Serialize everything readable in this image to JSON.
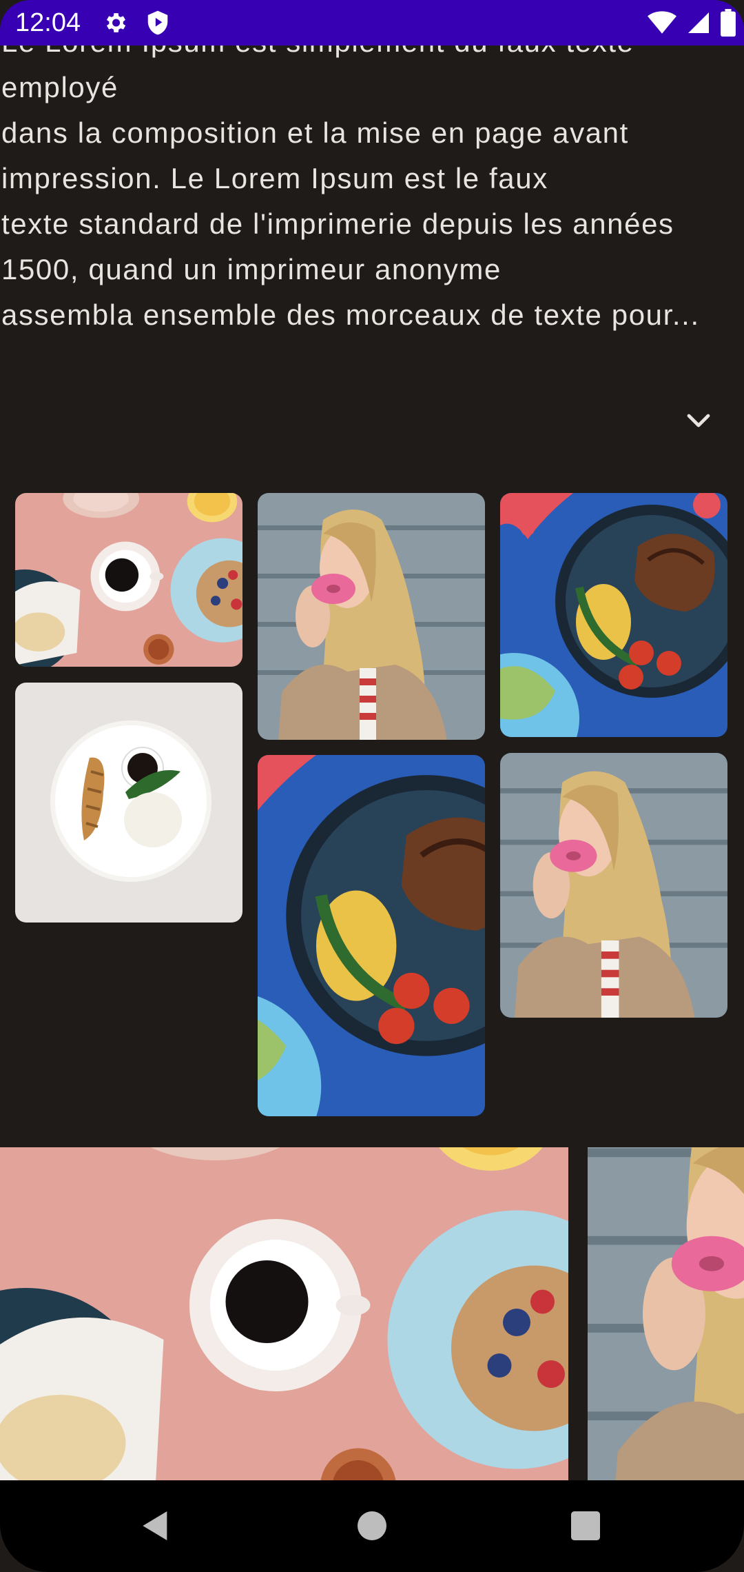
{
  "status_bar": {
    "time": "12:04",
    "background": "#3700b3",
    "left_icons": [
      "settings-icon",
      "shield-play-icon"
    ],
    "right_icons": [
      "wifi-icon",
      "cell-signal-icon",
      "battery-icon"
    ]
  },
  "content": {
    "description": "Le Lorem Ipsum est simplement du faux texte\nemployé\ndans la composition et la mise en page avant\nimpression. Le Lorem Ipsum est le faux\ntexte standard de l'imprimerie depuis les années\n1500, quand un imprimeur anonyme\nassembla ensemble des morceaux de texte pour...",
    "expand_icon": "chevron-down-icon",
    "gallery": [
      {
        "name": "photo-breakfast-table",
        "subject": "breakfast"
      },
      {
        "name": "photo-woman-donut",
        "subject": "woman"
      },
      {
        "name": "photo-steak-plate",
        "subject": "steak"
      },
      {
        "name": "photo-fish-rice-plate",
        "subject": "fish"
      },
      {
        "name": "photo-steak-plate-2",
        "subject": "steak"
      },
      {
        "name": "photo-woman-donut-2",
        "subject": "woman"
      }
    ],
    "carousel": [
      {
        "name": "carousel-breakfast",
        "subject": "breakfast"
      },
      {
        "name": "carousel-woman",
        "subject": "woman"
      }
    ]
  },
  "nav_bar": {
    "buttons": [
      "back-icon",
      "home-icon",
      "recents-icon"
    ]
  }
}
